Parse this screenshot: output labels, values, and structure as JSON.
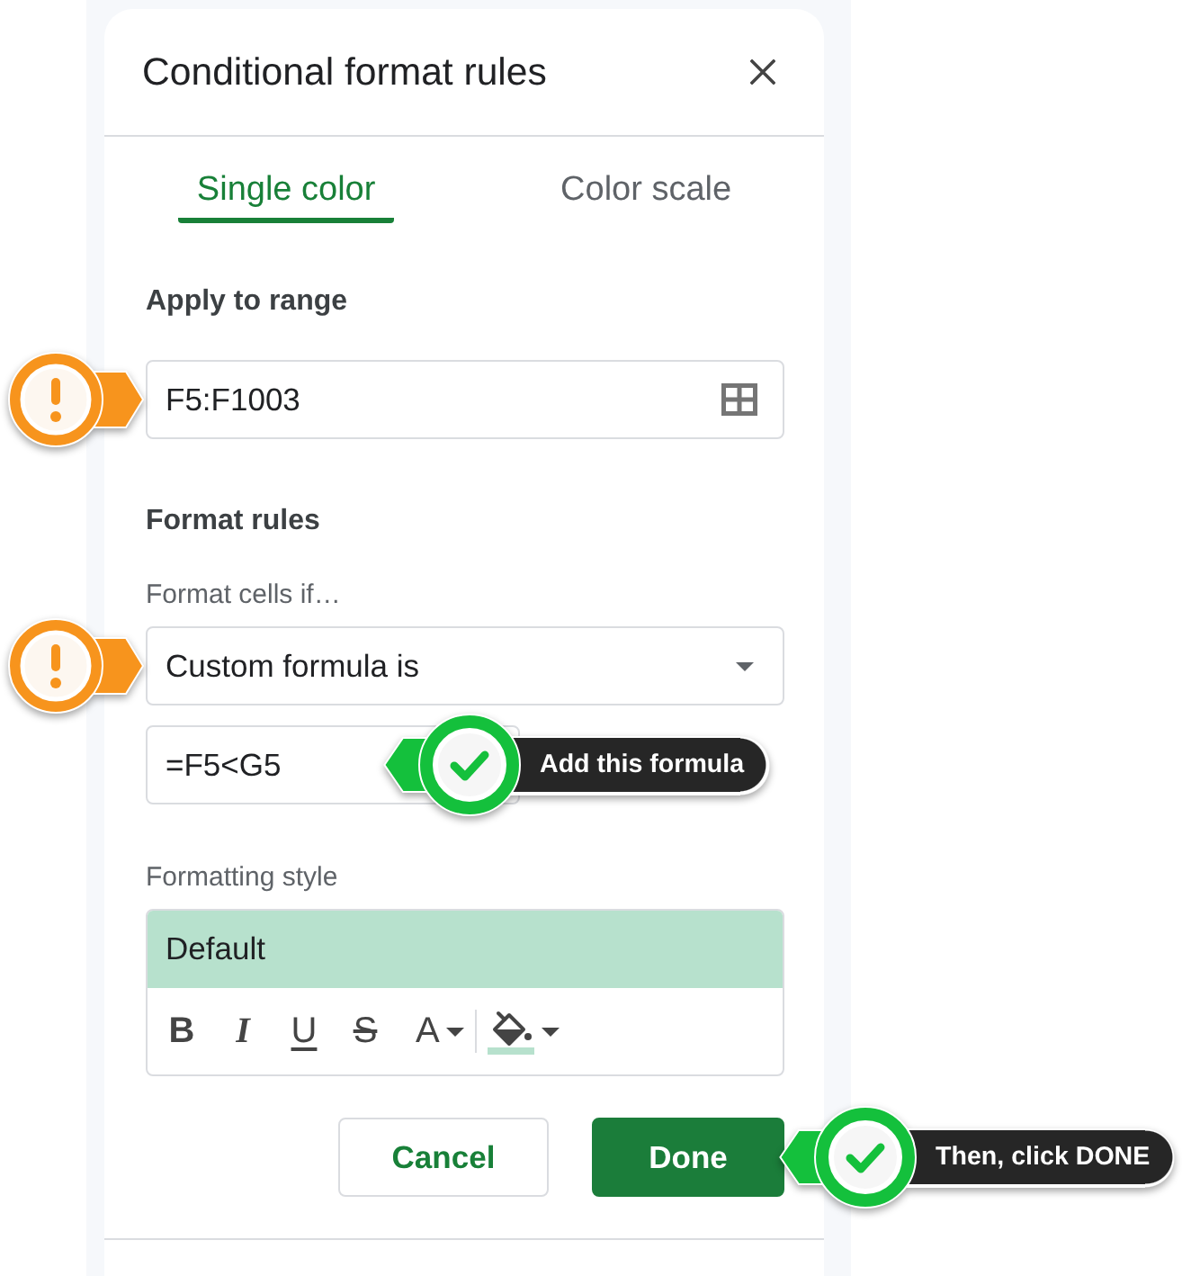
{
  "panel": {
    "title": "Conditional format rules"
  },
  "tabs": [
    {
      "label": "Single color",
      "selected": true
    },
    {
      "label": "Color scale",
      "selected": false
    }
  ],
  "range": {
    "label": "Apply to range",
    "value": "F5:F1003",
    "callout": {
      "kind": "warning"
    }
  },
  "format_rules": {
    "heading": "Format rules",
    "condition_label": "Format cells if…",
    "condition": {
      "value": "Custom formula is",
      "callout": {
        "kind": "warning"
      }
    },
    "formula": {
      "value": "=F5<G5",
      "callout": {
        "kind": "check",
        "text": "Add this formula"
      }
    }
  },
  "formatting_style": {
    "label": "Formatting style",
    "preset": "Default",
    "tools": [
      {
        "kind": "bold",
        "glyph": "B"
      },
      {
        "kind": "italic",
        "glyph": "I"
      },
      {
        "kind": "underline",
        "glyph": "U"
      },
      {
        "kind": "strikethrough",
        "glyph": "S"
      },
      {
        "kind": "text_color",
        "glyph": "A"
      },
      {
        "kind": "fill_color"
      }
    ]
  },
  "buttons": [
    {
      "label": "Cancel",
      "kind": "secondary"
    },
    {
      "label": "Done",
      "kind": "primary",
      "callout": {
        "kind": "check",
        "text": "Then, click DONE"
      }
    }
  ]
}
